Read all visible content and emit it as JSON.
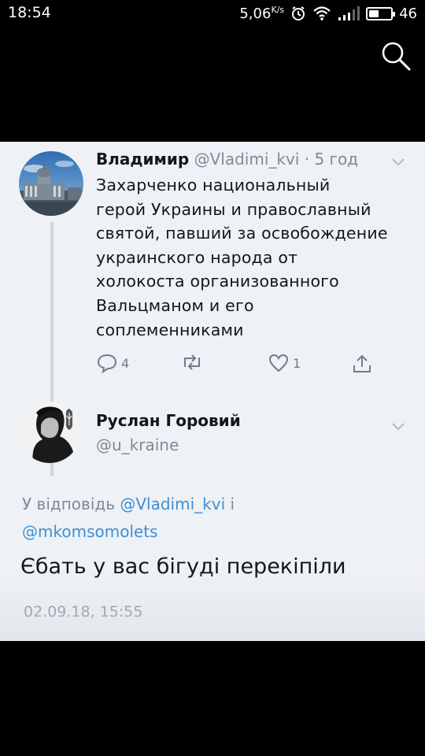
{
  "status_bar": {
    "time": "18:54",
    "net_speed": "5,06",
    "net_unit": "K/s",
    "battery_percent": 46,
    "battery_label": "46"
  },
  "colors": {
    "background": "#000000",
    "card": "#eef1f5",
    "link": "#3e8fd4",
    "muted": "#7d8c99"
  },
  "tweet1": {
    "name": "Владимир",
    "handle": "@Vladimi_kvi",
    "separator": "·",
    "time": "5 год",
    "text_lines": [
      "Захарченко национальный",
      "герой Украины и православный",
      "святой, павший за освобождение",
      "украинского народа от",
      "холокоста организованного",
      "Вальцманом и его",
      "соплеменниками"
    ],
    "reply_count": "4",
    "retweet_count": "",
    "like_count": "1"
  },
  "tweet2": {
    "name": "Руслан Горовий",
    "handle": "@u_kraine",
    "reply_prefix": "У відповідь",
    "reply_to_1": "@Vladimi_kvi",
    "reply_conj": "і",
    "reply_to_2": "@mkomsomolets",
    "text": "Єбать у вас бігуді перекіпіли",
    "date": "02.09.18, 15:55"
  }
}
